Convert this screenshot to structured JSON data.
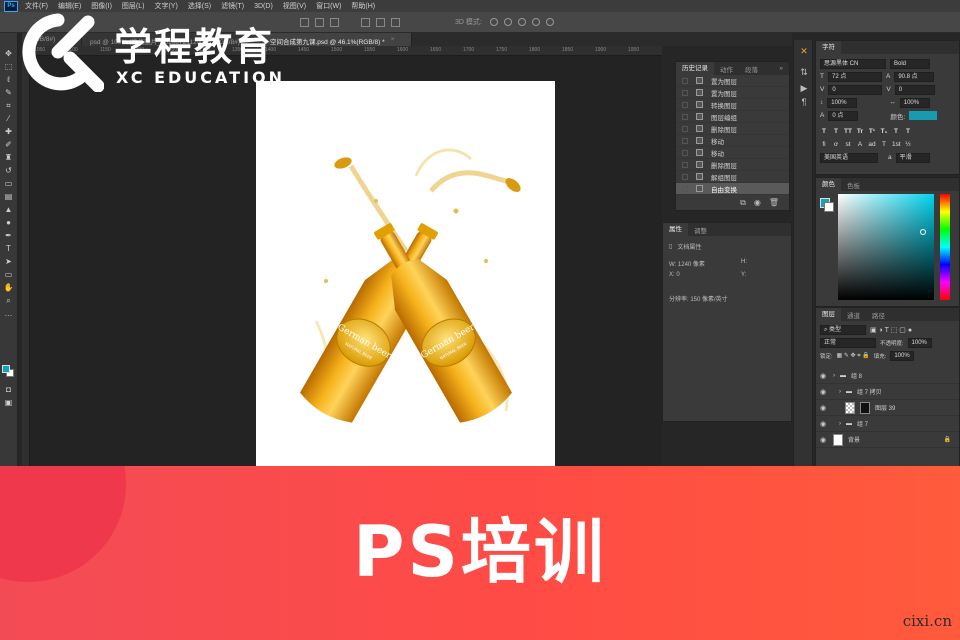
{
  "app": {
    "logo_text": "Ps",
    "menu": [
      "文件(F)",
      "编辑(E)",
      "图像(I)",
      "图层(L)",
      "文字(Y)",
      "选择(S)",
      "滤镜(T)",
      "3D(D)",
      "视图(V)",
      "窗口(W)",
      "帮助(H)"
    ],
    "options_3d_label": "3D 模式:"
  },
  "tabs": [
    {
      "label": "RGB/8#)",
      "active": false
    },
    {
      "label": "psd @ 100% (微信图片_20200721120005, RGB/8#)",
      "active": false
    },
    {
      "label": "空间合成第九课.psd @ 46.1%(RGB/8) *",
      "active": true
    }
  ],
  "ruler_ticks": [
    "1050",
    "1100",
    "1150",
    "1200",
    "1250",
    "1300",
    "1350",
    "1400",
    "1450",
    "1500",
    "1550",
    "1600",
    "1650",
    "1700",
    "1750",
    "1800",
    "1850",
    "1900",
    "1950"
  ],
  "history": {
    "tabs": [
      "历史记录",
      "动作",
      "段落"
    ],
    "items": [
      "置为图层",
      "置为图层",
      "转换图层",
      "图层编组",
      "删除图层",
      "移动",
      "移动",
      "删除图层",
      "解组图层",
      "自由变换"
    ]
  },
  "properties": {
    "tabs": [
      "属性",
      "调整"
    ],
    "section": "文档属性",
    "w": "W:  1240 像素",
    "h": "H:",
    "x": "X:  0",
    "y": "Y:",
    "resolution": "分辨率: 150 像素/英寸"
  },
  "character": {
    "tab": "字符",
    "font": "思源黑体 CN",
    "style": "Bold",
    "size": "72 点",
    "leading": "90.8 点",
    "kerning": "0",
    "tracking": "0",
    "vscale": "100%",
    "hscale": "100%",
    "baseline": "0 点",
    "color_label": "颜色:",
    "text_color": "#169cb0",
    "language": "美国英语",
    "aa": "平滑",
    "style_buttons": [
      "T",
      "T",
      "TT",
      "Tr",
      "T¹",
      "T₁",
      "T",
      "T"
    ],
    "ot_buttons": [
      "fi",
      "ơ",
      "st",
      "A",
      "ad",
      "T",
      "1st",
      "½"
    ]
  },
  "color_panel": {
    "tabs": [
      "颜色",
      "色板"
    ],
    "foreground": "#16a2b8"
  },
  "layers": {
    "tabs": [
      "图层",
      "通道",
      "路径"
    ],
    "kind": "类型",
    "blend": "正常",
    "opacity_label": "不透明度:",
    "opacity": "100%",
    "lock_label": "锁定:",
    "fill_label": "填充:",
    "fill": "100%",
    "items": [
      {
        "name": "组 8",
        "type": "group"
      },
      {
        "name": "组 7 拷贝",
        "type": "group"
      },
      {
        "name": "图层 39",
        "type": "layer"
      },
      {
        "name": "组 7",
        "type": "group"
      },
      {
        "name": "背景",
        "type": "background"
      }
    ]
  },
  "artwork": {
    "label_text": "German beer",
    "sublabel": "NATURAL BEER"
  },
  "brand": {
    "name_cn": "学程教育",
    "name_en": "XC EDUCATION"
  },
  "banner": {
    "title": "PS培训",
    "watermark": "cixi.cn"
  }
}
